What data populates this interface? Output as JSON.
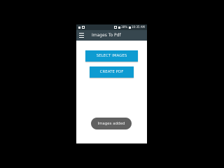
{
  "status_bar": {
    "battery": "38%",
    "time": "10:35 AM"
  },
  "app_bar": {
    "title": "Images To Pdf",
    "menu_icon": "hamburger-menu-icon"
  },
  "buttons": {
    "select_images": "SELECT IMAGES",
    "create_pdf": "CREATE PDF"
  },
  "toast": {
    "message": "Images added"
  },
  "colors": {
    "status_bar": "#263238",
    "app_bar": "#37474f",
    "button": "#0e9bd1",
    "toast": "#616161"
  }
}
